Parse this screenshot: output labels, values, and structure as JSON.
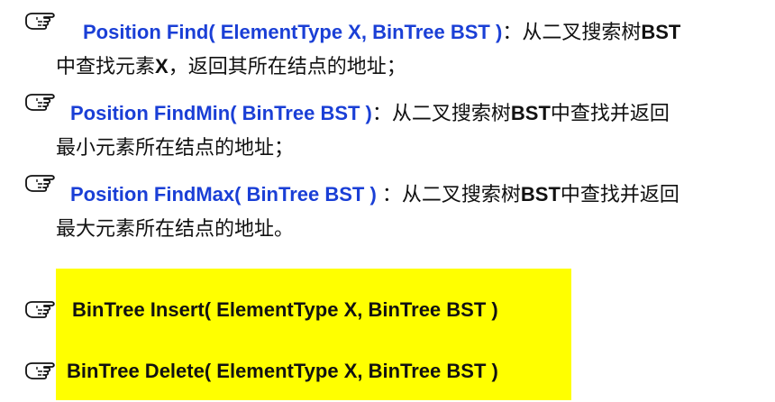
{
  "items": [
    {
      "signature": "Position Find( ElementType X, BinTree BST )",
      "desc_line1_a": "：从二叉搜索树",
      "desc_line1_b": "BST",
      "desc_line2_a": "中查找元素",
      "desc_line2_b": "X",
      "desc_line2_c": "，返回其所在结点的地址；"
    },
    {
      "signature": "Position FindMin( BinTree BST )",
      "desc_line1_a": "：从二叉搜索树",
      "desc_line1_b": "BST",
      "desc_line1_c": "中查找并返回",
      "desc_line2": "最小元素所在结点的地址；"
    },
    {
      "signature": "Position FindMax( BinTree BST )",
      "desc_line1_a": " ：从二叉搜索树",
      "desc_line1_b": "BST",
      "desc_line1_c": "中查找并返回",
      "desc_line2": "最大元素所在结点的地址。"
    }
  ],
  "highlighted": [
    {
      "signature": "BinTree  Insert( ElementType X, BinTree BST )"
    },
    {
      "signature": "BinTree  Delete( ElementType X, BinTree BST )"
    }
  ],
  "colors": {
    "signature": "#1a3fd6",
    "highlight": "#ffff00",
    "text": "#111111"
  },
  "icon": "pointing-hand-icon"
}
